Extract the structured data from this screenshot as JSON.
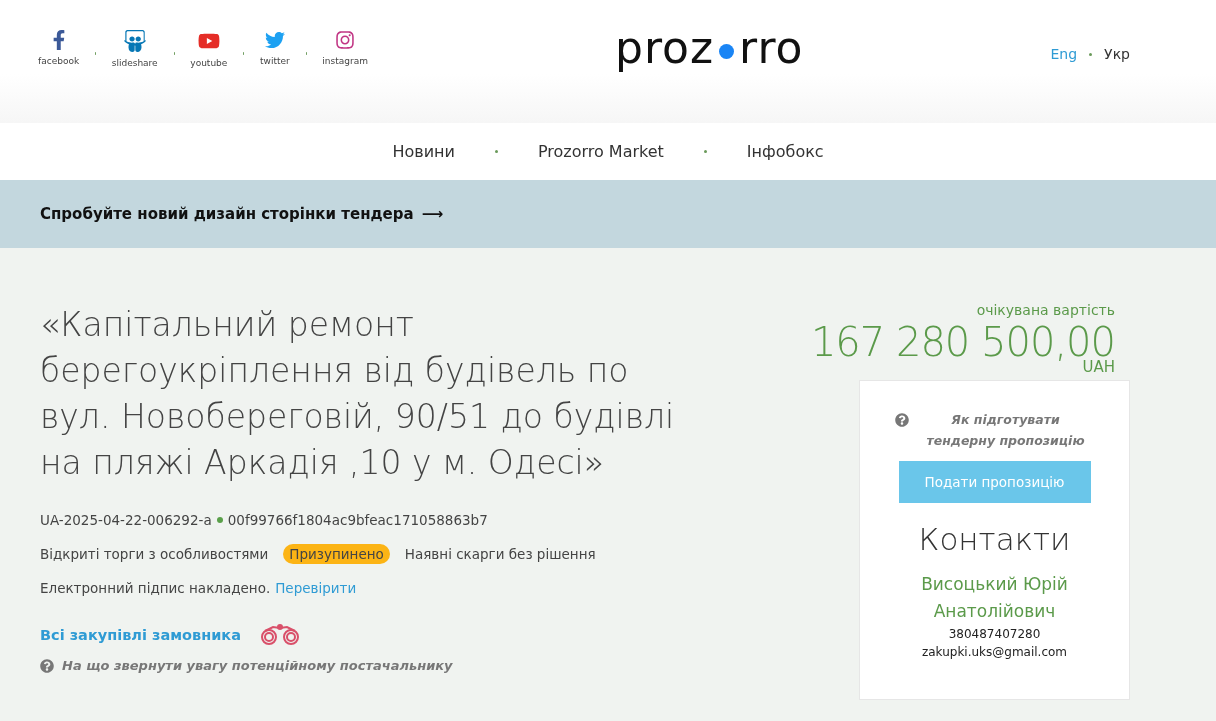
{
  "social": [
    {
      "kind": "facebook",
      "label": "facebook"
    },
    {
      "kind": "slideshare",
      "label": "slideshare"
    },
    {
      "kind": "youtube",
      "label": "youtube"
    },
    {
      "kind": "twitter",
      "label": "twitter"
    },
    {
      "kind": "instagram",
      "label": "instagram"
    }
  ],
  "logo": {
    "left": "proz",
    "right": "rro"
  },
  "languages": [
    {
      "label": "Eng",
      "selected": false
    },
    {
      "label": "Укр",
      "selected": true
    }
  ],
  "nav": [
    "Новини",
    "Prozorro Market",
    "Інфобокс"
  ],
  "banner": {
    "text": "Спробуйте новий дизайн сторінки тендера",
    "arrow": "⟶"
  },
  "tender": {
    "title": "«Капітальний ремонт берегоукріплення від будівель по вул. Новобереговій, 90/51 до будівлі на пляжі Аркадія ,10 у м. Одесі»",
    "id": "UA-2025-04-22-006292-a",
    "hash": "00f99766f1804ac9bfeac171058863b7",
    "procedure": "Відкриті торги з особливостями",
    "status": "Призупинено",
    "complaints": "Наявні скарги без рішення",
    "signature": "Електронний підпис накладено.",
    "verify_link": "Перевірити",
    "buyer_link": "Всі закупівлі замовника",
    "hint": "На що звернути увагу потенційному постачальнику"
  },
  "price": {
    "label": "очікувана вартість",
    "amount": "167 280 500,00",
    "currency": "UAH"
  },
  "card": {
    "help": "Як підготувати тендерну пропозицію",
    "button": "Подати пропозицію",
    "contacts_title": "Контакти",
    "name": "Висоцький Юрій Анатолійович",
    "phone": "380487407280",
    "email": "zakupki.uks@gmail.com"
  }
}
